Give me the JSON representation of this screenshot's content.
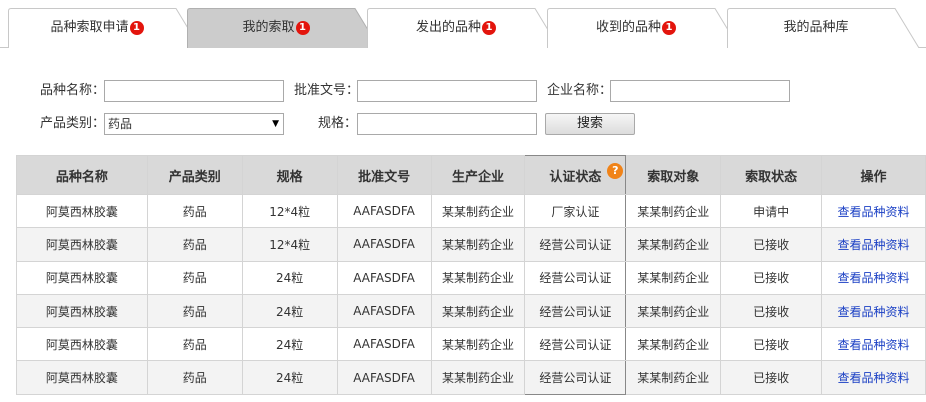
{
  "tabs": [
    {
      "label": "品种索取申请",
      "badge": "1",
      "active": false
    },
    {
      "label": "我的索取",
      "badge": "1",
      "active": true
    },
    {
      "label": "发出的品种",
      "badge": "1",
      "active": false
    },
    {
      "label": "收到的品种",
      "badge": "1",
      "active": false
    },
    {
      "label": "我的品种库",
      "badge": "",
      "active": false
    }
  ],
  "form": {
    "variety_name_label": "品种名称：",
    "approval_no_label": "批准文号：",
    "company_name_label": "企业名称：",
    "category_label": "产品类别：",
    "category_value": "药品",
    "spec_label": "规格：",
    "search_label": "搜索"
  },
  "table": {
    "headers": [
      "品种名称",
      "产品类别",
      "规格",
      "批准文号",
      "生产企业",
      "认证状态",
      "索取对象",
      "索取状态",
      "操作"
    ],
    "rows": [
      [
        "阿莫西林胶囊",
        "药品",
        "12*4粒",
        "AAFASDFA",
        "某某制药企业",
        "厂家认证",
        "某某制药企业",
        "申请中",
        "查看品种资料"
      ],
      [
        "阿莫西林胶囊",
        "药品",
        "12*4粒",
        "AAFASDFA",
        "某某制药企业",
        "经营公司认证",
        "某某制药企业",
        "已接收",
        "查看品种资料"
      ],
      [
        "阿莫西林胶囊",
        "药品",
        "24粒",
        "AAFASDFA",
        "某某制药企业",
        "经营公司认证",
        "某某制药企业",
        "已接收",
        "查看品种资料"
      ],
      [
        "阿莫西林胶囊",
        "药品",
        "24粒",
        "AAFASDFA",
        "某某制药企业",
        "经营公司认证",
        "某某制药企业",
        "已接收",
        "查看品种资料"
      ],
      [
        "阿莫西林胶囊",
        "药品",
        "24粒",
        "AAFASDFA",
        "某某制药企业",
        "经营公司认证",
        "某某制药企业",
        "已接收",
        "查看品种资料"
      ],
      [
        "阿莫西林胶囊",
        "药品",
        "24粒",
        "AAFASDFA",
        "某某制药企业",
        "经营公司认证",
        "某某制药企业",
        "已接收",
        "查看品种资料"
      ]
    ]
  },
  "help_icon": "?",
  "colors": {
    "active_tab": "#cccccc",
    "inactive_tab": "#ffffff",
    "badge": "#e3150d",
    "help_icon": "#f08318",
    "link": "#1a3fc4",
    "header_bg": "#d9d9d9"
  }
}
